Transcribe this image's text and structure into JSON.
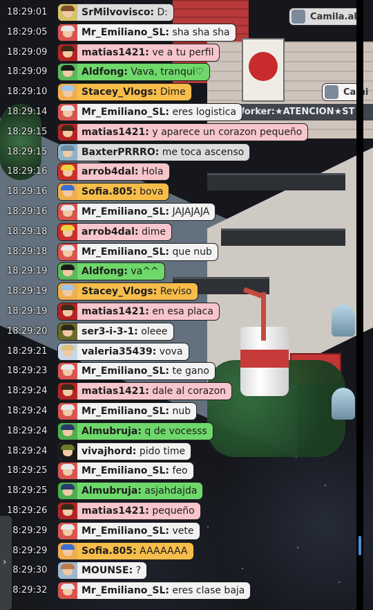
{
  "room": {
    "top_user_tag": "Camila.al",
    "top_user_tag_2": "Cami",
    "worker_banner": "Worker:★ATENCION★ST"
  },
  "theme": {
    "pink": "#f7c5cc",
    "white": "#f2f2f2",
    "green": "#6ed86a",
    "orange": "#f7bd4a",
    "gray": "#dcdcdc"
  },
  "messages": [
    {
      "time": "18:29:01",
      "user": "SrMilvovisco:",
      "text": "D:",
      "color": "gray",
      "avatar": "#d4c36a",
      "hair": "#7a4f2a"
    },
    {
      "time": "18:29:05",
      "user": "Mr_Emiliano_SL:",
      "text": "sha sha sha",
      "color": "white",
      "avatar": "#d9534f",
      "hair": "#e7e7e7"
    },
    {
      "time": "18:29:09",
      "user": "matias1421:",
      "text": "ve a tu perfil",
      "color": "pink",
      "avatar": "#b52424",
      "hair": "#3b2a1a"
    },
    {
      "time": "18:29:09",
      "user": "Aldfong:",
      "text": "Vava, tranqui♡",
      "color": "green",
      "avatar": "#5cb85c",
      "hair": "#1a1a1a"
    },
    {
      "time": "18:29:10",
      "user": "Stacey_Vlogs:",
      "text": "Dime",
      "color": "orange",
      "avatar": "#f0ad4e",
      "hair": "#9ac7e8"
    },
    {
      "time": "18:29:14",
      "user": "Mr_Emiliano_SL:",
      "text": "eres logistica",
      "color": "white",
      "avatar": "#d9534f",
      "hair": "#e7e7e7"
    },
    {
      "time": "18:29:15",
      "user": "matias1421:",
      "text": "y aparece un corazon pequeño",
      "color": "pink",
      "avatar": "#b52424",
      "hair": "#3b2a1a"
    },
    {
      "time": "18:29:15",
      "user": "BaxterPRRRO:",
      "text": "me toca ascenso",
      "color": "gray",
      "avatar": "#8fb3c9",
      "hair": "#6a8fa6"
    },
    {
      "time": "18:29:16",
      "user": "arrob4dal:",
      "text": "Hola",
      "color": "pink",
      "avatar": "#c9302c",
      "hair": "#f0d040"
    },
    {
      "time": "18:29:16",
      "user": "Sofia.805:",
      "text": "bova",
      "color": "orange",
      "avatar": "#f0ad4e",
      "hair": "#3a6fd0"
    },
    {
      "time": "18:29:16",
      "user": "Mr_Emiliano_SL:",
      "text": "JAJAJAJA",
      "color": "white",
      "avatar": "#d9534f",
      "hair": "#e7e7e7"
    },
    {
      "time": "18:29:18",
      "user": "arrob4dal:",
      "text": "dime",
      "color": "pink",
      "avatar": "#c9302c",
      "hair": "#f0d040"
    },
    {
      "time": "18:29:18",
      "user": "Mr_Emiliano_SL:",
      "text": "que nub",
      "color": "white",
      "avatar": "#d9534f",
      "hair": "#e7e7e7"
    },
    {
      "time": "18:29:19",
      "user": "Aldfong:",
      "text": "va^^",
      "color": "green",
      "avatar": "#5cb85c",
      "hair": "#1a1a1a"
    },
    {
      "time": "18:29:19",
      "user": "Stacey_Vlogs:",
      "text": "Reviso",
      "color": "orange",
      "avatar": "#f0ad4e",
      "hair": "#9ac7e8"
    },
    {
      "time": "18:29:19",
      "user": "matias1421:",
      "text": "en esa placa",
      "color": "pink",
      "avatar": "#b52424",
      "hair": "#3b2a1a"
    },
    {
      "time": "18:29:20",
      "user": "ser3-i-3-1:",
      "text": "oleee",
      "color": "white",
      "avatar": "#6b6b2a",
      "hair": "#2a2a1a"
    },
    {
      "time": "18:29:21",
      "user": "valeria35439:",
      "text": "vova",
      "color": "white",
      "avatar": "#c8d8e8",
      "hair": "#e0c080"
    },
    {
      "time": "18:29:23",
      "user": "Mr_Emiliano_SL:",
      "text": "te gano",
      "color": "white",
      "avatar": "#d9534f",
      "hair": "#e7e7e7"
    },
    {
      "time": "18:29:24",
      "user": "matias1421:",
      "text": "dale al corazon",
      "color": "pink",
      "avatar": "#b52424",
      "hair": "#3b2a1a"
    },
    {
      "time": "18:29:24",
      "user": "Mr_Emiliano_SL:",
      "text": "nub",
      "color": "white",
      "avatar": "#d9534f",
      "hair": "#e7e7e7"
    },
    {
      "time": "18:29:24",
      "user": "Almubruja:",
      "text": "q de vocesss",
      "color": "green",
      "avatar": "#4cae4c",
      "hair": "#2a3a6a"
    },
    {
      "time": "18:29:24",
      "user": "vivajhord:",
      "text": "pido time",
      "color": "white",
      "avatar": "#1a1a1a",
      "hair": "#6b7a2a"
    },
    {
      "time": "18:29:25",
      "user": "Mr_Emiliano_SL:",
      "text": "feo",
      "color": "white",
      "avatar": "#d9534f",
      "hair": "#e7e7e7"
    },
    {
      "time": "18:29:25",
      "user": "Almubruja:",
      "text": "asjahdajda",
      "color": "green",
      "avatar": "#4cae4c",
      "hair": "#2a3a6a"
    },
    {
      "time": "18:29:26",
      "user": "matias1421:",
      "text": "pequeño",
      "color": "pink",
      "avatar": "#b52424",
      "hair": "#3b2a1a"
    },
    {
      "time": "18:29:29",
      "user": "Mr_Emiliano_SL:",
      "text": "vete",
      "color": "white",
      "avatar": "#d9534f",
      "hair": "#e7e7e7"
    },
    {
      "time": "18:29:29",
      "user": "Sofia.805:",
      "text": "AAAAAAA",
      "color": "orange",
      "avatar": "#f0ad4e",
      "hair": "#3a6fd0"
    },
    {
      "time": "18:29:30",
      "user": "MOUNSE:",
      "text": "?",
      "color": "white",
      "avatar": "#9fb8d0",
      "hair": "#c07a4a"
    },
    {
      "time": "18:29:32",
      "user": "Mr_Emiliano_SL:",
      "text": "eres clase baja",
      "color": "white",
      "avatar": "#d9534f",
      "hair": "#e7e7e7"
    }
  ]
}
